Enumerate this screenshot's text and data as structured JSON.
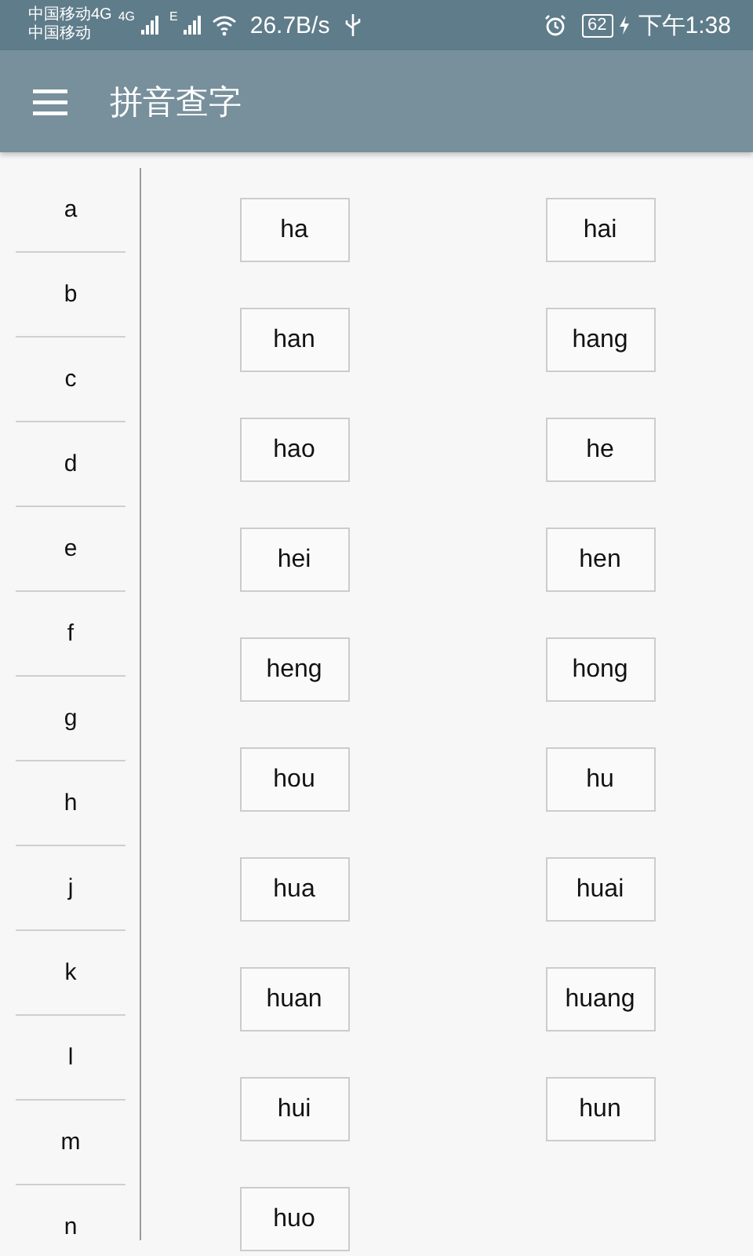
{
  "status_bar": {
    "carrier_1": "中国移动4G",
    "carrier_2": "中国移动",
    "network_1": "4G",
    "network_2": "E",
    "speed": "26.7B/s",
    "battery": "62",
    "time": "下午1:38"
  },
  "app_bar": {
    "title": "拼音查字"
  },
  "letters": [
    {
      "label": "a"
    },
    {
      "label": "b"
    },
    {
      "label": "c"
    },
    {
      "label": "d"
    },
    {
      "label": "e"
    },
    {
      "label": "f"
    },
    {
      "label": "g"
    },
    {
      "label": "h"
    },
    {
      "label": "j"
    },
    {
      "label": "k"
    },
    {
      "label": "l"
    },
    {
      "label": "m"
    },
    {
      "label": "n"
    }
  ],
  "syllables": [
    "ha",
    "hai",
    "han",
    "hang",
    "hao",
    "he",
    "hei",
    "hen",
    "heng",
    "hong",
    "hou",
    "hu",
    "hua",
    "huai",
    "huan",
    "huang",
    "hui",
    "hun",
    "huo"
  ]
}
